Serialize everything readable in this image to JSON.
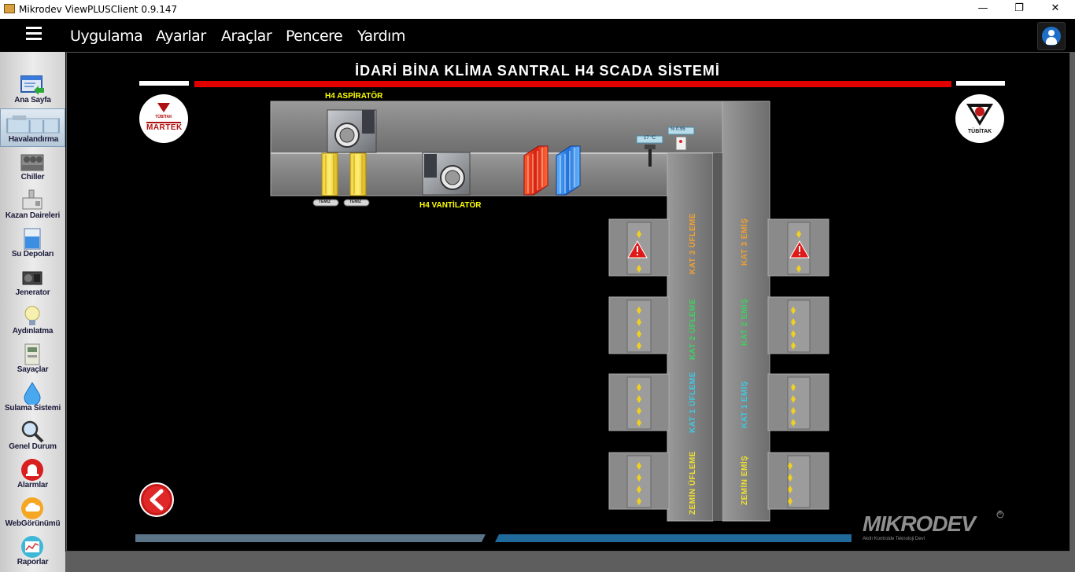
{
  "window": {
    "title": "Mikrodev ViewPLUSClient 0.9.147",
    "controls": {
      "minimize": "—",
      "restore": "❐",
      "close": "✕"
    }
  },
  "menu": {
    "items": [
      "Uygulama",
      "Ayarlar",
      "Araçlar",
      "Pencere",
      "Yardım"
    ]
  },
  "sidebar": {
    "active_index": 1,
    "items": [
      {
        "label": "Ana Sayfa",
        "icon": "home-screen-icon"
      },
      {
        "label": "Havalandırma",
        "icon": "ventilation-icon"
      },
      {
        "label": "Chiller",
        "icon": "chiller-icon"
      },
      {
        "label": "Kazan Daireleri",
        "icon": "boiler-icon"
      },
      {
        "label": "Su Depoları",
        "icon": "water-tank-icon"
      },
      {
        "label": "Jenerator",
        "icon": "generator-icon"
      },
      {
        "label": "Aydınlatma",
        "icon": "bulb-icon"
      },
      {
        "label": "Sayaçlar",
        "icon": "meter-icon"
      },
      {
        "label": "Sulama Sistemi",
        "icon": "water-drop-icon"
      },
      {
        "label": "Genel Durum",
        "icon": "magnifier-icon"
      },
      {
        "label": "Alarmlar",
        "icon": "alarm-siren-icon"
      },
      {
        "label": "WebGörünümü",
        "icon": "cloud-icon"
      },
      {
        "label": "Raporlar",
        "icon": "report-chart-icon"
      }
    ]
  },
  "scada": {
    "title": "İDARİ BİNA KLİMA SANTRAL H4 SCADA SİSTEMİ",
    "aspirator_label": "H4 ASPİRATÖR",
    "vantilator_label": "H4 VANTİLATÖR",
    "filter_tag_1": "TEMİZ",
    "filter_tag_2": "TEMİZ",
    "temperature_readout": "17 °C",
    "humidity_readout": "% 0.95",
    "logo_left": "MARTEK",
    "logo_left_small": "TÜBİTAK",
    "logo_right": "TÜBİTAK",
    "brand": "MIKRODEV",
    "brand_tagline": "Akıllı Kontrolde Teknoloji Devi",
    "registered_mark": "®",
    "floors": [
      {
        "supply": "KAT 3  ÜFLEME",
        "exhaust": "KAT 3  EMİŞ",
        "color": "#f0a030",
        "alarm": true
      },
      {
        "supply": "KAT 2  ÜFLEME",
        "exhaust": "KAT 2  EMİŞ",
        "color": "#3ed060",
        "alarm": false
      },
      {
        "supply": "KAT 1  ÜFLEME",
        "exhaust": "KAT 1  EMİŞ",
        "color": "#3fc8e0",
        "alarm": false
      },
      {
        "supply": "ZEMİN  ÜFLEME",
        "exhaust": "ZEMİN  EMİŞ",
        "color": "#f0e030",
        "alarm": false
      }
    ],
    "colors": {
      "duct": "#7d7d7d",
      "duct_edge": "#a9a9a9",
      "title_red": "#e00000",
      "label_yellow": "#ffff00",
      "brand_gray": "#8f8f8f"
    }
  }
}
